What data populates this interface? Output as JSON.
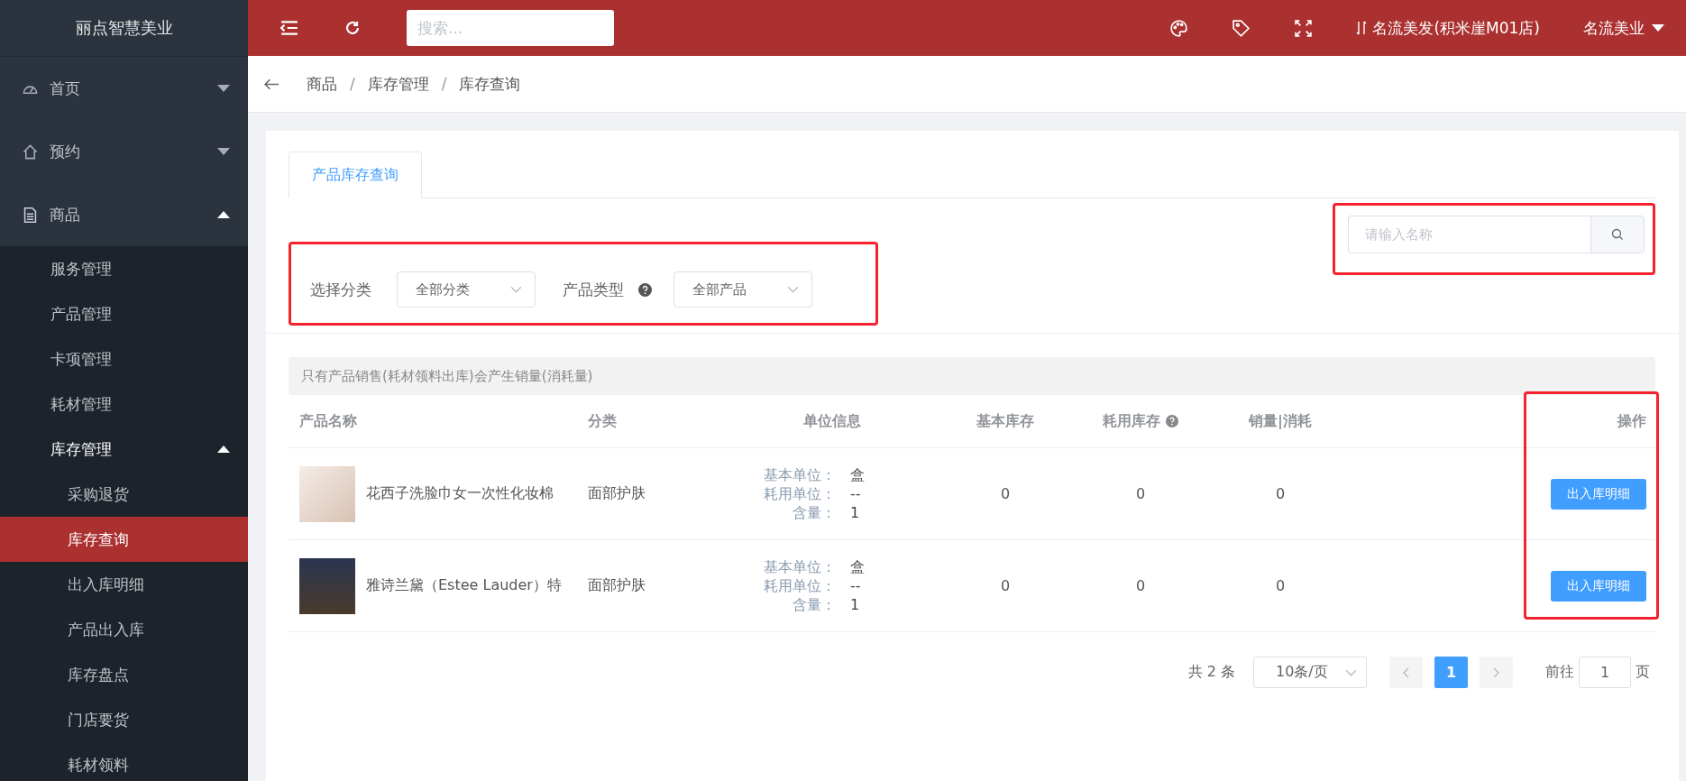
{
  "sidebar": {
    "brand": "丽点智慧美业",
    "items": [
      {
        "label": "首页",
        "expanded": false,
        "selected": false
      },
      {
        "label": "预约",
        "expanded": false,
        "selected": false
      },
      {
        "label": "商品",
        "expanded": true,
        "selected": false,
        "children": [
          {
            "label": "服务管理",
            "selected": false
          },
          {
            "label": "产品管理",
            "selected": false
          },
          {
            "label": "卡项管理",
            "selected": false
          },
          {
            "label": "耗材管理",
            "selected": false
          },
          {
            "label": "库存管理",
            "expanded": true,
            "selected": false,
            "children": [
              {
                "label": "采购退货",
                "selected": false
              },
              {
                "label": "库存查询",
                "selected": true
              },
              {
                "label": "出入库明细",
                "selected": false
              },
              {
                "label": "产品出入库",
                "selected": false
              },
              {
                "label": "库存盘点",
                "selected": false
              },
              {
                "label": "门店要货",
                "selected": false
              },
              {
                "label": "耗材领料",
                "selected": false
              }
            ]
          }
        ]
      }
    ]
  },
  "topbar": {
    "search_placeholder": "搜索...",
    "store": "名流美发(积米崖M01店)",
    "user": "名流美业"
  },
  "breadcrumb": {
    "separator": "/",
    "items": [
      "商品",
      "库存管理",
      "库存查询"
    ]
  },
  "tabs": [
    {
      "label": "产品库存查询",
      "selected": true
    }
  ],
  "search": {
    "placeholder": "请输入名称",
    "highlighted": true
  },
  "filters": {
    "highlighted": true,
    "items": [
      {
        "label": "选择分类",
        "help": false,
        "value": "全部分类"
      },
      {
        "label": "产品类型",
        "help": true,
        "value": "全部产品"
      }
    ]
  },
  "notice": "只有产品销售(耗材领料出库)会产生销量(消耗量)",
  "table": {
    "actions_highlighted": true,
    "columns": [
      {
        "label": "产品名称",
        "help": false
      },
      {
        "label": "分类",
        "help": false
      },
      {
        "label": "单位信息",
        "help": false
      },
      {
        "label": "基本库存",
        "help": false
      },
      {
        "label": "耗用库存",
        "help": true
      },
      {
        "label": "销量|消耗",
        "help": false
      },
      {
        "label": "操作",
        "help": false
      }
    ],
    "rows": [
      {
        "name": "花西子洗脸巾女一次性化妆棉",
        "category": "面部护肤",
        "units": [
          {
            "label": "基本单位：",
            "value": "盒"
          },
          {
            "label": "耗用单位：",
            "value": "--"
          },
          {
            "label": "含量：",
            "value": "1"
          }
        ],
        "basic_stock": "0",
        "use_stock": "0",
        "sales": "0",
        "action": "出入库明细"
      },
      {
        "name": "雅诗兰黛（Estee Lauder）特",
        "category": "面部护肤",
        "units": [
          {
            "label": "基本单位：",
            "value": "盒"
          },
          {
            "label": "耗用单位：",
            "value": "--"
          },
          {
            "label": "含量：",
            "value": "1"
          }
        ],
        "basic_stock": "0",
        "use_stock": "0",
        "sales": "0",
        "action": "出入库明细"
      }
    ]
  },
  "pagination": {
    "total": "共 2 条",
    "page_size": "10条/页",
    "pages": [
      {
        "label": "1",
        "selected": true
      }
    ],
    "goto_label": "前往",
    "goto_value": "1",
    "page_suffix": "页"
  }
}
